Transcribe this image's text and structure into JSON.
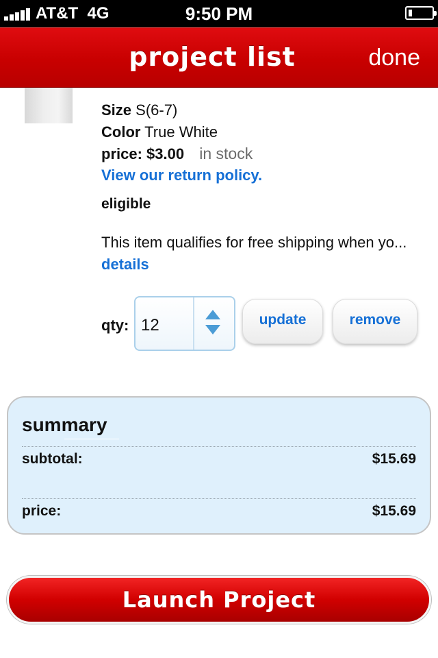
{
  "status_bar": {
    "carrier": "AT&T",
    "network": "4G",
    "time": "9:50 PM",
    "battery_level": 0.15
  },
  "nav": {
    "title": "project list",
    "done_label": "done"
  },
  "item": {
    "size_label": "Size",
    "size_value": "S(6-7)",
    "color_label": "Color",
    "color_value": "True White",
    "price_label": "price:",
    "price_value": "$3.00",
    "stock_status": "in stock",
    "return_policy_link": "View our return policy.",
    "eligibility": "eligible",
    "description": "This item qualifies for free shipping when yo...",
    "details_link": "details"
  },
  "quantity": {
    "label": "qty:",
    "value": "12",
    "update_label": "update",
    "remove_label": "remove"
  },
  "summary": {
    "heading": "summary",
    "subtotal_label": "subtotal:",
    "subtotal_value": "$15.69",
    "price_label": "price:",
    "price_value": "$15.69"
  },
  "launch_label": "Launch Project",
  "colors": {
    "brand_red": "#c80000",
    "link_blue": "#1670d6",
    "summary_bg": "#dff0fc"
  }
}
